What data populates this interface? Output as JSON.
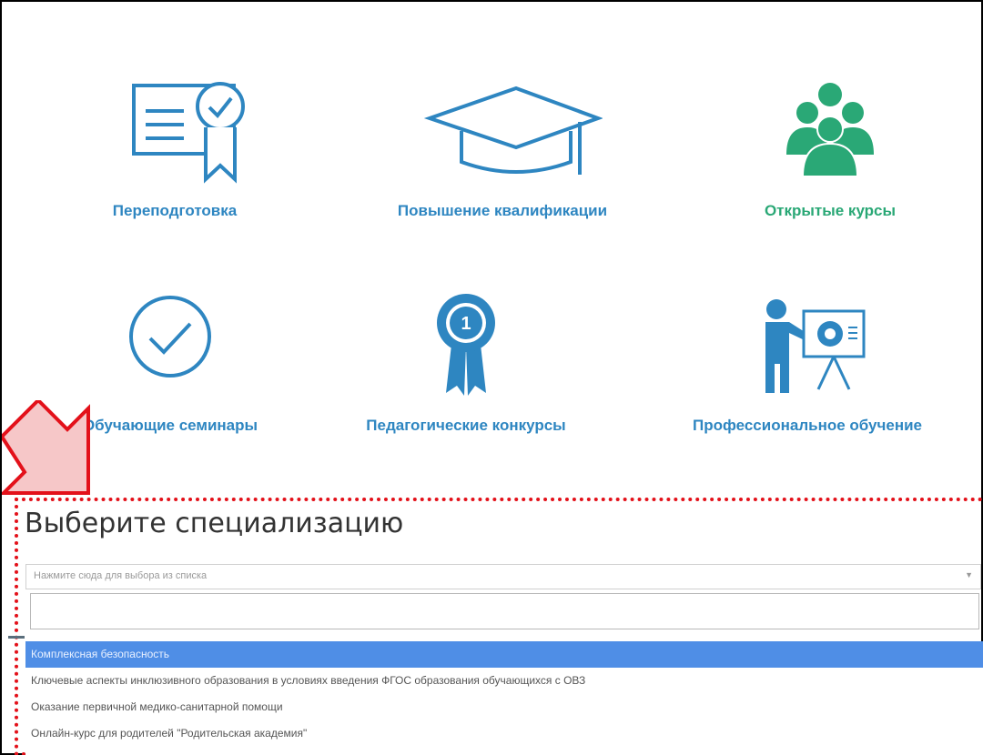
{
  "categories": {
    "retraining": {
      "label": "Переподготовка",
      "icon": "certificate-icon"
    },
    "qualification": {
      "label": "Повышение квалификации",
      "icon": "graduation-cap-icon"
    },
    "open_courses": {
      "label": "Открытые курсы",
      "icon": "group-people-icon"
    },
    "seminars": {
      "label": "Обучающие семинары",
      "icon": "check-circle-icon"
    },
    "contests": {
      "label": "Педагогические конкурсы",
      "icon": "award-ribbon-icon"
    },
    "professional": {
      "label": "Профессиональное обучение",
      "icon": "presentation-teacher-icon"
    }
  },
  "specialization": {
    "title": "Выберите специализацию",
    "select_placeholder": "Нажмите сюда для выбора из списка",
    "search_value": "",
    "options": [
      "Комплексная безопасность",
      "Ключевые аспекты инклюзивного образования в условиях введения ФГОС образования обучающихся с ОВЗ",
      "Оказание первичной медико-санитарной помощи",
      "Онлайн-курс для родителей \"Родительская академия\""
    ],
    "selected_index": 0
  },
  "colors": {
    "blue": "#2e86c1",
    "green": "#2aa876",
    "highlight": "#4f8ee6",
    "annotation": "#e3111a"
  }
}
